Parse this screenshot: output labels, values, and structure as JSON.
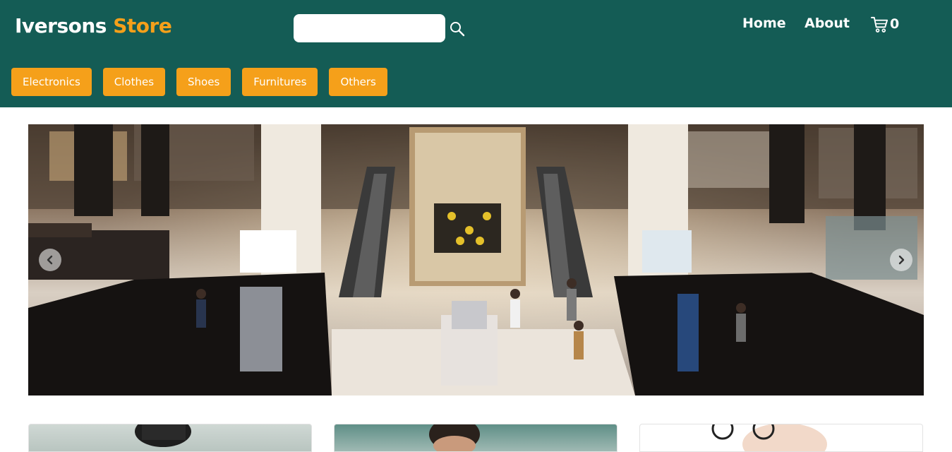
{
  "header": {
    "brand_part1": "Iversons",
    "brand_part2": "Store",
    "search": {
      "placeholder": "",
      "value": ""
    },
    "nav": {
      "home": "Home",
      "about": "About"
    },
    "cart_count": "0"
  },
  "categories": [
    "Electronics",
    "Clothes",
    "Shoes",
    "Furnitures",
    "Others"
  ],
  "colors": {
    "header_bg": "#145c55",
    "accent": "#f5a01a",
    "text_light": "#ffffff"
  },
  "icons": {
    "search": "search-icon",
    "cart": "cart-icon",
    "prev": "chevron-left-icon",
    "next": "chevron-right-icon"
  }
}
